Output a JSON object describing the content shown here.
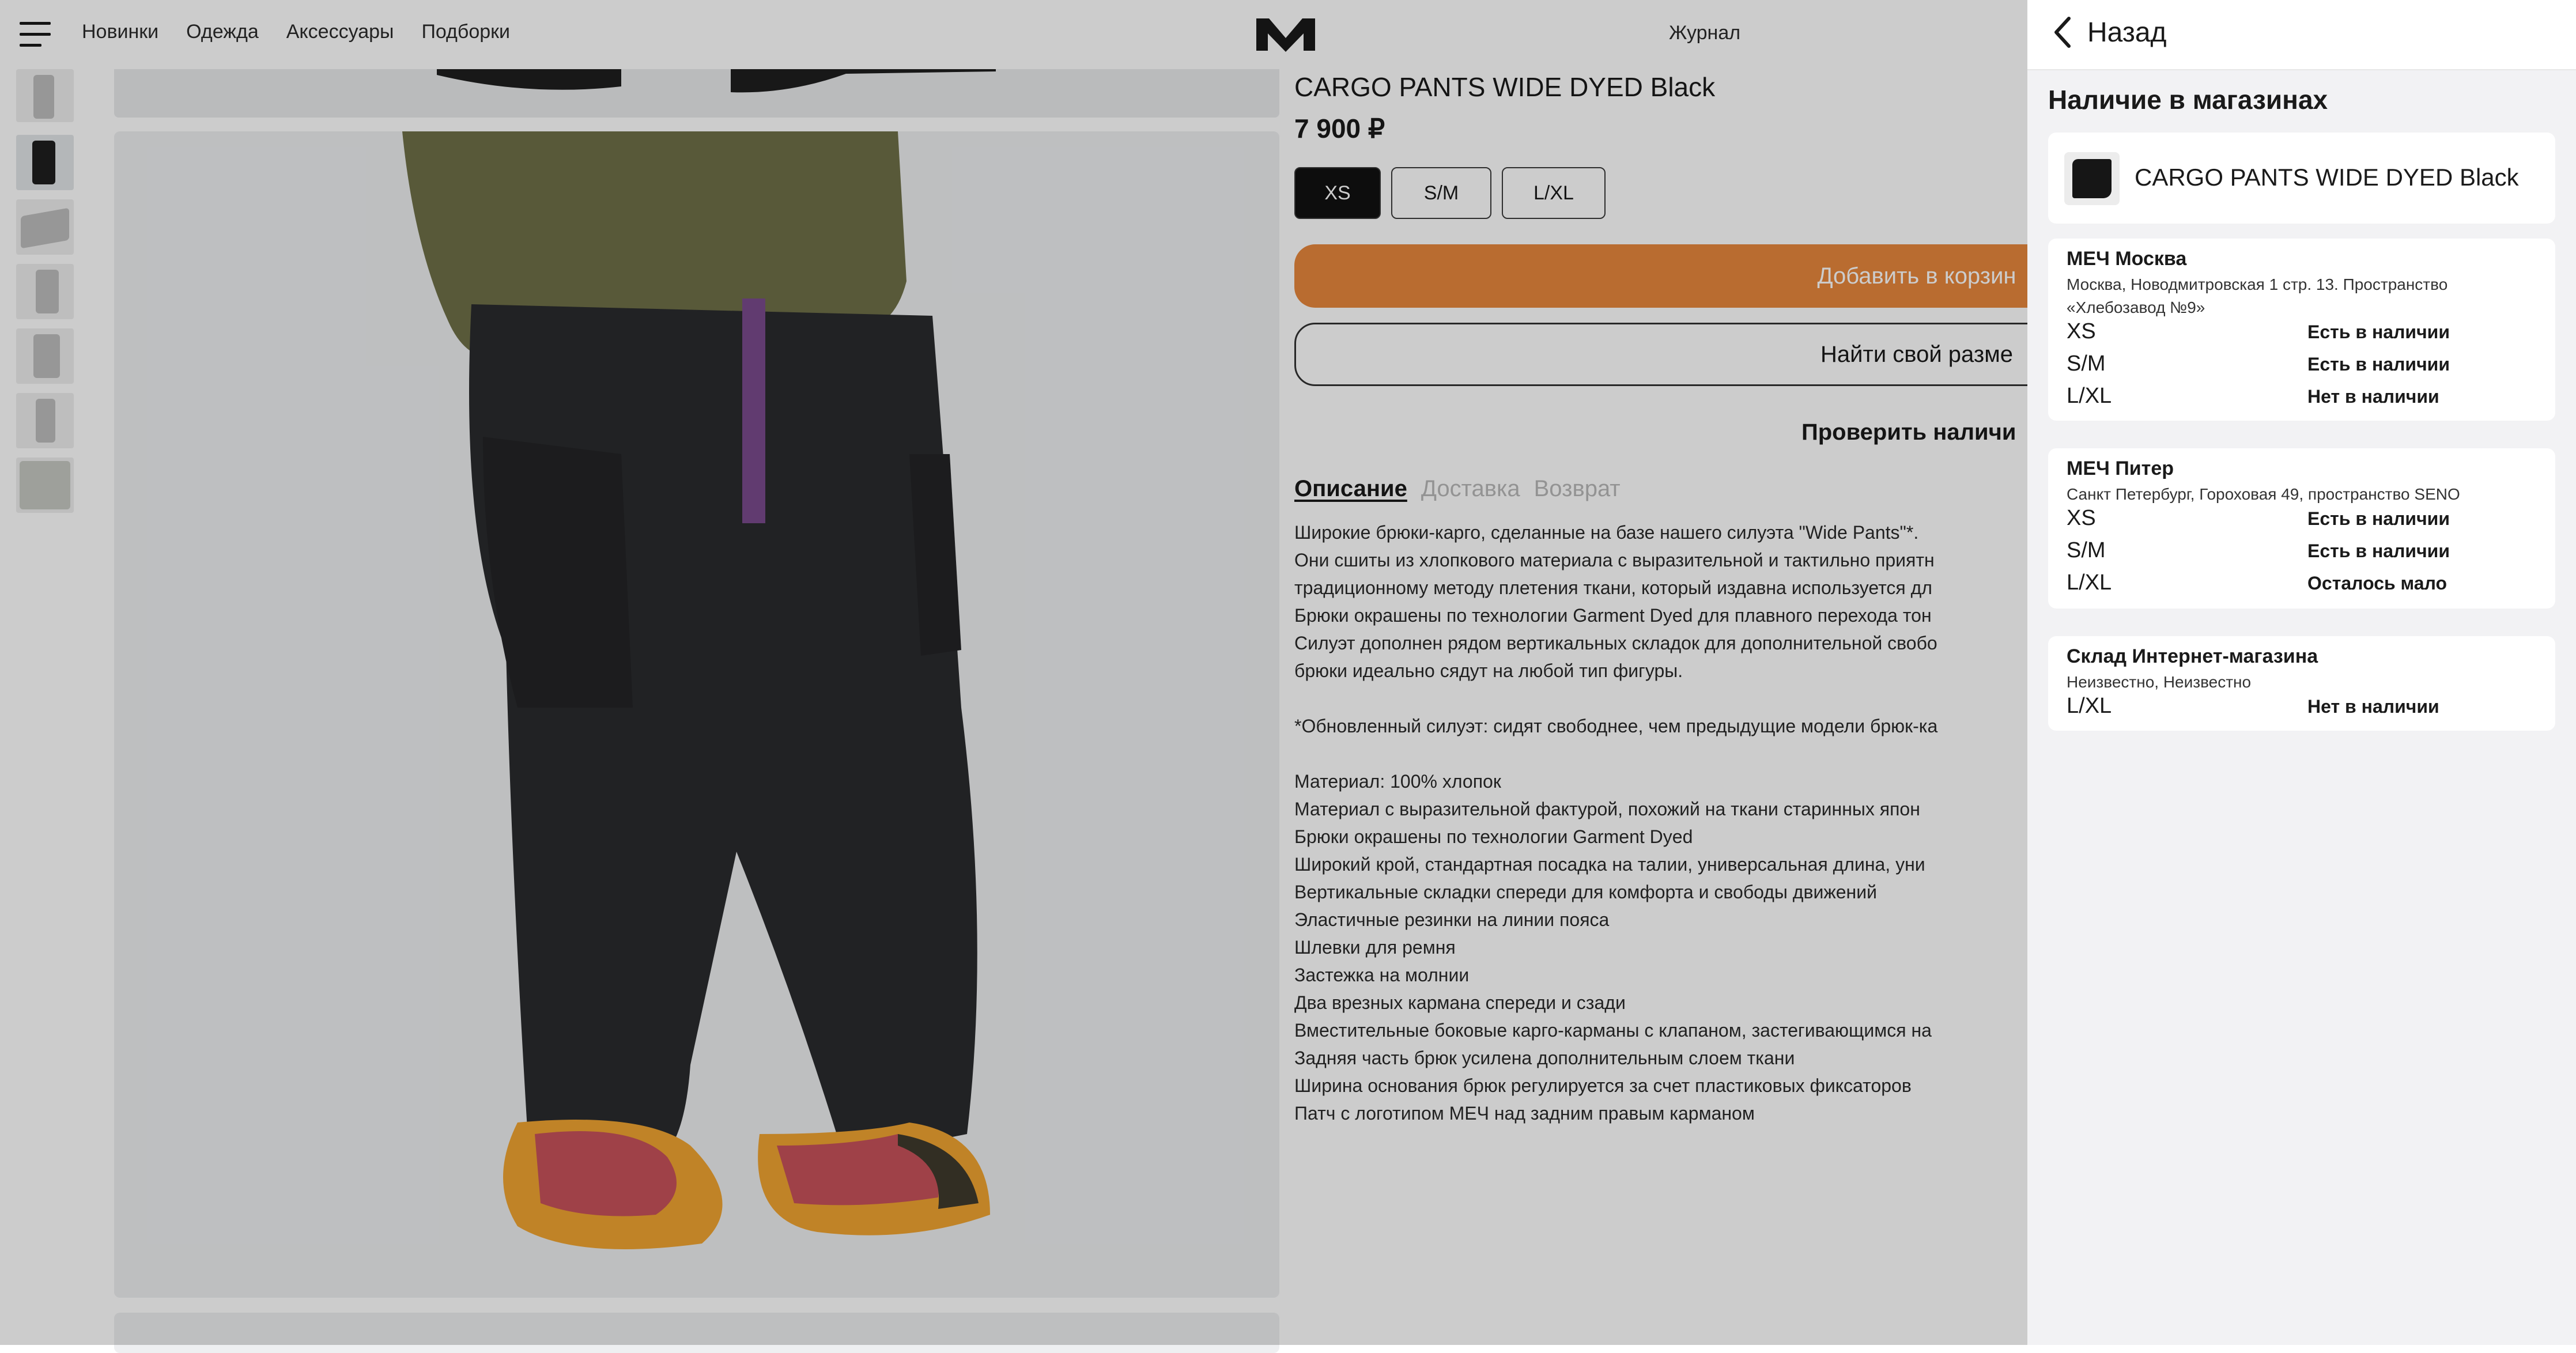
{
  "header": {
    "nav": [
      "Новинки",
      "Одежда",
      "Аксессуары",
      "Подборки"
    ],
    "logo": "M",
    "journal": "Журнал"
  },
  "product": {
    "title": "CARGO PANTS WIDE DYED Black",
    "price": "7 900 ₽",
    "sizes": [
      {
        "label": "XS",
        "selected": true
      },
      {
        "label": "S/M",
        "selected": false
      },
      {
        "label": "L/XL",
        "selected": false
      }
    ],
    "add_to_cart": "Добавить в корзин",
    "find_size": "Найти свой разме",
    "check_availability": "Проверить наличи",
    "tabs": [
      "Описание",
      "Доставка",
      "Возврат"
    ],
    "description": [
      "Широкие брюки-карго, сделанные на базе нашего силуэта \"Wide Pants\"*.",
      "Они сшиты из хлопкового материала с выразительной и тактильно приятн",
      "традиционному методу плетения ткани, который издавна используется дл",
      "Брюки окрашены по технологии Garment Dyed для плавного перехода тон",
      "Силуэт дополнен рядом вертикальных складок для дополнительной свобо",
      "брюки идеально сядут на любой тип фигуры.",
      "",
      "*Обновленный силуэт: сидят свободнее, чем предыдущие модели брюк-ка",
      "",
      "Материал: 100% хлопок",
      "Материал с выразительной фактурой, похожий на ткани старинных япон",
      "Брюки окрашены по технологии Garment Dyed",
      "Широкий крой, стандартная посадка на талии, универсальная длина, уни",
      "Вертикальные складки спереди для комфорта и свободы движений",
      "Эластичные резинки на линии пояса",
      "Шлевки для ремня",
      "Застежка на молнии",
      "Два врезных кармана спереди и сзади",
      "Вместительные боковые карго-карманы с клапаном, застегивающимся на",
      "Задняя часть брюк усилена дополнительным слоем ткани",
      "Ширина основания брюк регулируется за счет пластиковых фиксаторов",
      "Патч с логотипом МЕЧ над задним правым карманом"
    ]
  },
  "drawer": {
    "back_label": "Назад",
    "title": "Наличие в магазинах",
    "product_name": "CARGO PANTS WIDE DYED Black",
    "stores": [
      {
        "name": "МЕЧ Москва",
        "address": "Москва, Новодмитровская 1 стр. 13. Пространство «Хлебозавод №9»",
        "rows": [
          {
            "size": "XS",
            "status": "Есть в наличии"
          },
          {
            "size": "S/M",
            "status": "Есть в наличии"
          },
          {
            "size": "L/XL",
            "status": "Нет в наличии"
          }
        ]
      },
      {
        "name": "МЕЧ Питер",
        "address": "Санкт Петербург, Гороховая 49, пространство SENO",
        "rows": [
          {
            "size": "XS",
            "status": "Есть в наличии"
          },
          {
            "size": "S/M",
            "status": "Есть в наличии"
          },
          {
            "size": "L/XL",
            "status": "Осталось мало"
          }
        ]
      },
      {
        "name": "Склад Интернет-магазина",
        "address": "Неизвестно, Неизвестно",
        "rows": [
          {
            "size": "L/XL",
            "status": "Нет в наличии"
          }
        ]
      }
    ]
  },
  "colors": {
    "accent": "#e8873c",
    "dark": "#111111",
    "drawer_bg": "#f2f2f4"
  }
}
